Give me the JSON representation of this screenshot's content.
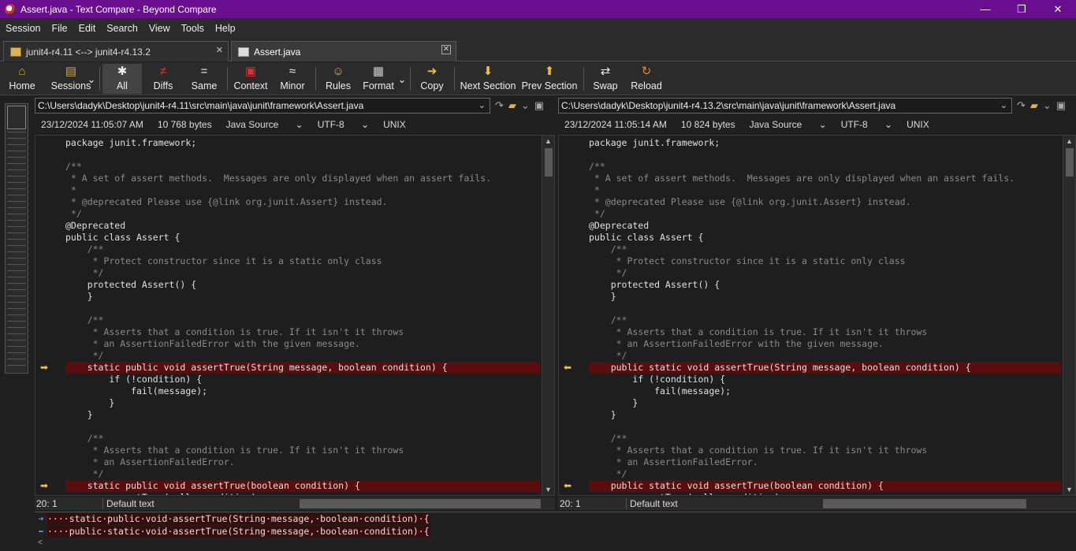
{
  "window": {
    "title": "Assert.java - Text Compare - Beyond Compare",
    "min": "—",
    "max": "❐",
    "close": "✕"
  },
  "menu": [
    "Session",
    "File",
    "Edit",
    "Search",
    "View",
    "Tools",
    "Help"
  ],
  "tabs": [
    {
      "label": "junit4-r4.11 <--> junit4-r4.13.2",
      "close": "✕"
    },
    {
      "label": "Assert.java",
      "close": "✕"
    }
  ],
  "toolbar": {
    "home": "Home",
    "sessions": "Sessions",
    "all": "All",
    "diffs": "Diffs",
    "same": "Same",
    "context": "Context",
    "minor": "Minor",
    "rules": "Rules",
    "format": "Format",
    "copy": "Copy",
    "next_section": "Next Section",
    "prev_section": "Prev Section",
    "swap": "Swap",
    "reload": "Reload",
    "icons": {
      "home": "⌂",
      "sessions": "▤",
      "all": "✱",
      "diffs": "≠",
      "same": "=",
      "context": "▣",
      "minor": "≈",
      "rules": "☺",
      "format": "▦",
      "copy": "➜",
      "next": "⬇",
      "prev": "⬆",
      "swap": "⇄",
      "reload": "↻",
      "dropdown": "⌄"
    }
  },
  "left": {
    "path": "C:\\Users\\dadyk\\Desktop\\junit4-r4.11\\src\\main\\java\\junit\\framework\\Assert.java",
    "date": "23/12/2024 11:05:07 AM",
    "size": "10 768 bytes",
    "format": "Java Source",
    "encoding": "UTF-8",
    "eol": "UNIX",
    "cursor": "20: 1",
    "mode": "Default text"
  },
  "right": {
    "path": "C:\\Users\\dadyk\\Desktop\\junit4-r4.13.2\\src\\main\\java\\junit\\framework\\Assert.java",
    "date": "23/12/2024 11:05:14 AM",
    "size": "10 824 bytes",
    "format": "Java Source",
    "encoding": "UTF-8",
    "eol": "UNIX",
    "cursor": "20: 1",
    "mode": "Default text"
  },
  "left_lines": [
    "package junit.framework;",
    "",
    "/**",
    " * A set of assert methods.  Messages are only displayed when an assert fails.",
    " *",
    " * @deprecated Please use {@link org.junit.Assert} instead.",
    " */",
    "@Deprecated",
    "public class Assert {",
    "    /**",
    "     * Protect constructor since it is a static only class",
    "     */",
    "    protected Assert() {",
    "    }",
    "",
    "    /**",
    "     * Asserts that a condition is true. If it isn't it throws",
    "     * an AssertionFailedError with the given message.",
    "     */",
    "    static public void assertTrue(String message, boolean condition) {",
    "        if (!condition) {",
    "            fail(message);",
    "        }",
    "    }",
    "",
    "    /**",
    "     * Asserts that a condition is true. If it isn't it throws",
    "     * an AssertionFailedError.",
    "     */",
    "    static public void assertTrue(boolean condition) {",
    "        assertTrue(null, condition);"
  ],
  "right_lines": [
    "package junit.framework;",
    "",
    "/**",
    " * A set of assert methods.  Messages are only displayed when an assert fails.",
    " *",
    " * @deprecated Please use {@link org.junit.Assert} instead.",
    " */",
    "@Deprecated",
    "public class Assert {",
    "    /**",
    "     * Protect constructor since it is a static only class",
    "     */",
    "    protected Assert() {",
    "    }",
    "",
    "    /**",
    "     * Asserts that a condition is true. If it isn't it throws",
    "     * an AssertionFailedError with the given message.",
    "     */",
    "    public static void assertTrue(String message, boolean condition) {",
    "        if (!condition) {",
    "            fail(message);",
    "        }",
    "    }",
    "",
    "    /**",
    "     * Asserts that a condition is true. If it isn't it throws",
    "     * an AssertionFailedError.",
    "     */",
    "    public static void assertTrue(boolean condition) {",
    "        assertTrue(null, condition);"
  ],
  "bottom": {
    "left_line": "····static·public·void·assertTrue(String·message,·boolean·condition)·{",
    "right_line": "····public·static·void·assertTrue(String·message,·boolean·condition)·{"
  }
}
